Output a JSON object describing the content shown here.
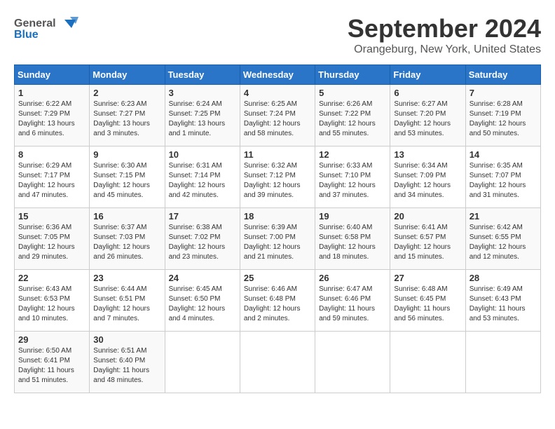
{
  "header": {
    "logo_line1": "General",
    "logo_line2": "Blue",
    "month": "September 2024",
    "location": "Orangeburg, New York, United States"
  },
  "weekdays": [
    "Sunday",
    "Monday",
    "Tuesday",
    "Wednesday",
    "Thursday",
    "Friday",
    "Saturday"
  ],
  "weeks": [
    [
      {
        "day": 1,
        "rise": "6:22 AM",
        "set": "7:29 PM",
        "daylight": "13 hours and 6 minutes."
      },
      {
        "day": 2,
        "rise": "6:23 AM",
        "set": "7:27 PM",
        "daylight": "13 hours and 3 minutes."
      },
      {
        "day": 3,
        "rise": "6:24 AM",
        "set": "7:25 PM",
        "daylight": "13 hours and 1 minute."
      },
      {
        "day": 4,
        "rise": "6:25 AM",
        "set": "7:24 PM",
        "daylight": "12 hours and 58 minutes."
      },
      {
        "day": 5,
        "rise": "6:26 AM",
        "set": "7:22 PM",
        "daylight": "12 hours and 55 minutes."
      },
      {
        "day": 6,
        "rise": "6:27 AM",
        "set": "7:20 PM",
        "daylight": "12 hours and 53 minutes."
      },
      {
        "day": 7,
        "rise": "6:28 AM",
        "set": "7:19 PM",
        "daylight": "12 hours and 50 minutes."
      }
    ],
    [
      {
        "day": 8,
        "rise": "6:29 AM",
        "set": "7:17 PM",
        "daylight": "12 hours and 47 minutes."
      },
      {
        "day": 9,
        "rise": "6:30 AM",
        "set": "7:15 PM",
        "daylight": "12 hours and 45 minutes."
      },
      {
        "day": 10,
        "rise": "6:31 AM",
        "set": "7:14 PM",
        "daylight": "12 hours and 42 minutes."
      },
      {
        "day": 11,
        "rise": "6:32 AM",
        "set": "7:12 PM",
        "daylight": "12 hours and 39 minutes."
      },
      {
        "day": 12,
        "rise": "6:33 AM",
        "set": "7:10 PM",
        "daylight": "12 hours and 37 minutes."
      },
      {
        "day": 13,
        "rise": "6:34 AM",
        "set": "7:09 PM",
        "daylight": "12 hours and 34 minutes."
      },
      {
        "day": 14,
        "rise": "6:35 AM",
        "set": "7:07 PM",
        "daylight": "12 hours and 31 minutes."
      }
    ],
    [
      {
        "day": 15,
        "rise": "6:36 AM",
        "set": "7:05 PM",
        "daylight": "12 hours and 29 minutes."
      },
      {
        "day": 16,
        "rise": "6:37 AM",
        "set": "7:03 PM",
        "daylight": "12 hours and 26 minutes."
      },
      {
        "day": 17,
        "rise": "6:38 AM",
        "set": "7:02 PM",
        "daylight": "12 hours and 23 minutes."
      },
      {
        "day": 18,
        "rise": "6:39 AM",
        "set": "7:00 PM",
        "daylight": "12 hours and 21 minutes."
      },
      {
        "day": 19,
        "rise": "6:40 AM",
        "set": "6:58 PM",
        "daylight": "12 hours and 18 minutes."
      },
      {
        "day": 20,
        "rise": "6:41 AM",
        "set": "6:57 PM",
        "daylight": "12 hours and 15 minutes."
      },
      {
        "day": 21,
        "rise": "6:42 AM",
        "set": "6:55 PM",
        "daylight": "12 hours and 12 minutes."
      }
    ],
    [
      {
        "day": 22,
        "rise": "6:43 AM",
        "set": "6:53 PM",
        "daylight": "12 hours and 10 minutes."
      },
      {
        "day": 23,
        "rise": "6:44 AM",
        "set": "6:51 PM",
        "daylight": "12 hours and 7 minutes."
      },
      {
        "day": 24,
        "rise": "6:45 AM",
        "set": "6:50 PM",
        "daylight": "12 hours and 4 minutes."
      },
      {
        "day": 25,
        "rise": "6:46 AM",
        "set": "6:48 PM",
        "daylight": "12 hours and 2 minutes."
      },
      {
        "day": 26,
        "rise": "6:47 AM",
        "set": "6:46 PM",
        "daylight": "11 hours and 59 minutes."
      },
      {
        "day": 27,
        "rise": "6:48 AM",
        "set": "6:45 PM",
        "daylight": "11 hours and 56 minutes."
      },
      {
        "day": 28,
        "rise": "6:49 AM",
        "set": "6:43 PM",
        "daylight": "11 hours and 53 minutes."
      }
    ],
    [
      {
        "day": 29,
        "rise": "6:50 AM",
        "set": "6:41 PM",
        "daylight": "11 hours and 51 minutes."
      },
      {
        "day": 30,
        "rise": "6:51 AM",
        "set": "6:40 PM",
        "daylight": "11 hours and 48 minutes."
      },
      null,
      null,
      null,
      null,
      null
    ]
  ]
}
